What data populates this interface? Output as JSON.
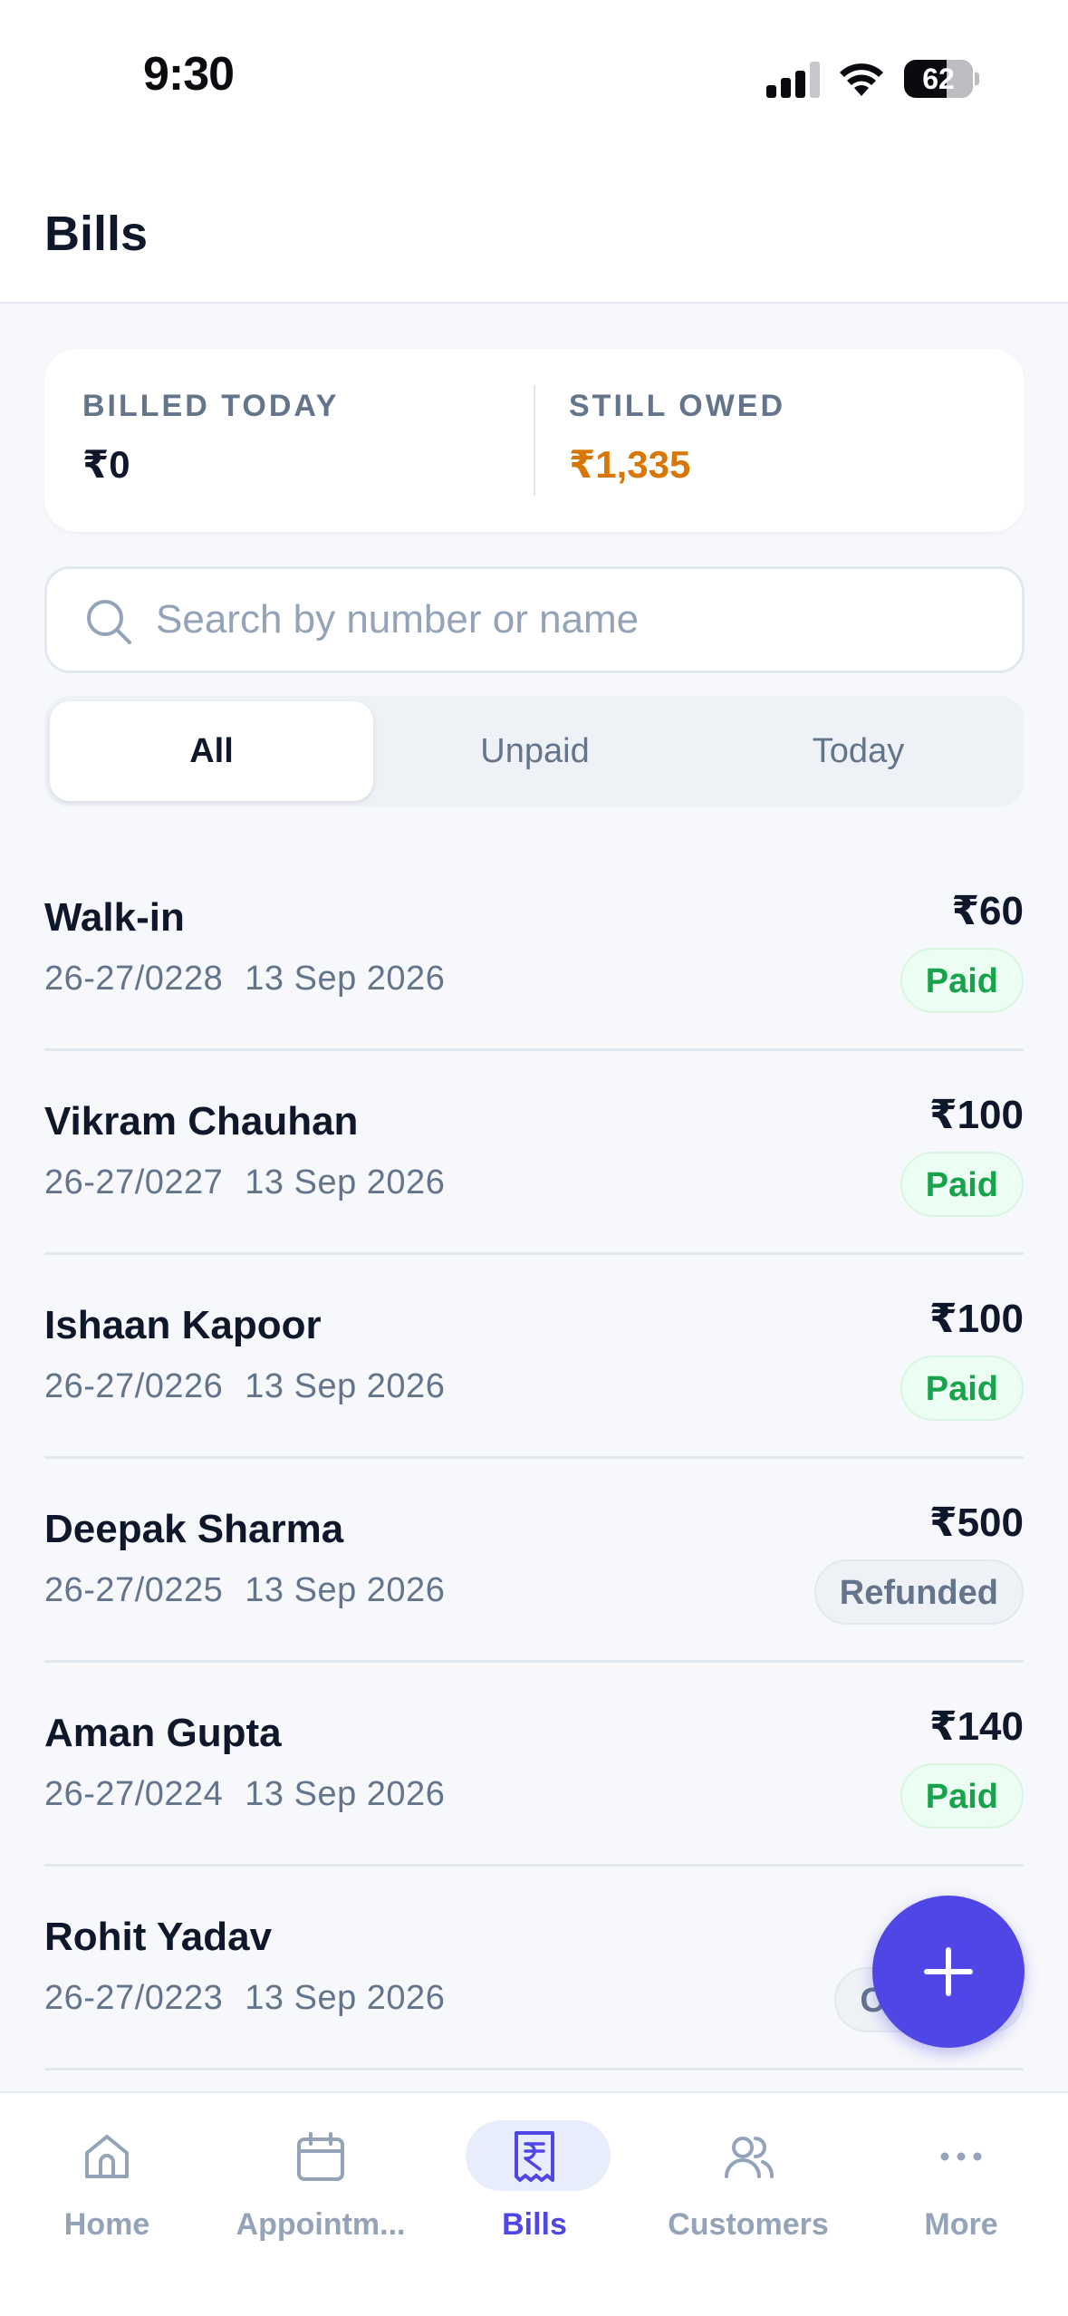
{
  "status_bar": {
    "time": "9:30",
    "battery": "62"
  },
  "header": {
    "title": "Bills"
  },
  "summary": {
    "billed_today_label": "BILLED TODAY",
    "billed_today_value": "₹0",
    "still_owed_label": "STILL OWED",
    "still_owed_value": "₹1,335"
  },
  "search": {
    "placeholder": "Search by number or name",
    "value": ""
  },
  "tabs": [
    {
      "label": "All",
      "active": true
    },
    {
      "label": "Unpaid",
      "active": false
    },
    {
      "label": "Today",
      "active": false
    }
  ],
  "bills": [
    {
      "name": "Walk-in",
      "number": "26-27/0228",
      "date": "13 Sep 2026",
      "amount": "₹60",
      "status": "Paid"
    },
    {
      "name": "Vikram Chauhan",
      "number": "26-27/0227",
      "date": "13 Sep 2026",
      "amount": "₹100",
      "status": "Paid"
    },
    {
      "name": "Ishaan Kapoor",
      "number": "26-27/0226",
      "date": "13 Sep 2026",
      "amount": "₹100",
      "status": "Paid"
    },
    {
      "name": "Deepak Sharma",
      "number": "26-27/0225",
      "date": "13 Sep 2026",
      "amount": "₹500",
      "status": "Refunded"
    },
    {
      "name": "Aman Gupta",
      "number": "26-27/0224",
      "date": "13 Sep 2026",
      "amount": "₹140",
      "status": "Paid"
    },
    {
      "name": "Rohit Yadav",
      "number": "26-27/0223",
      "date": "13 Sep 2026",
      "amount": "",
      "status": "Ca"
    }
  ],
  "fab": {
    "icon": "plus-icon"
  },
  "bottom_nav": [
    {
      "label": "Home",
      "icon": "home-icon",
      "active": false
    },
    {
      "label": "Appointm...",
      "icon": "calendar-icon",
      "active": false
    },
    {
      "label": "Bills",
      "icon": "receipt-rupee-icon",
      "active": true
    },
    {
      "label": "Customers",
      "icon": "users-icon",
      "active": false
    },
    {
      "label": "More",
      "icon": "more-icon",
      "active": false
    }
  ],
  "colors": {
    "accent": "#4f46e5",
    "owed": "#d97706",
    "paid": "#16a34a",
    "muted": "#64748b"
  }
}
